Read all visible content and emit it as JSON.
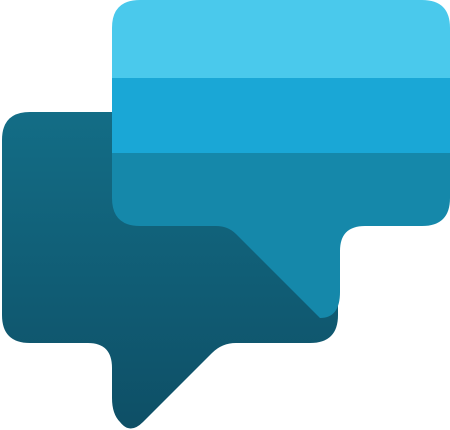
{
  "logo": {
    "icon": "two-chat-bubbles-icon",
    "colors": {
      "back_bubble_top": "#136d86",
      "back_bubble_bottom": "#0e4f66",
      "front_band_top": "#4ac9ec",
      "front_band_middle": "#1aa7d6",
      "front_band_bottom": "#1588aa"
    }
  }
}
